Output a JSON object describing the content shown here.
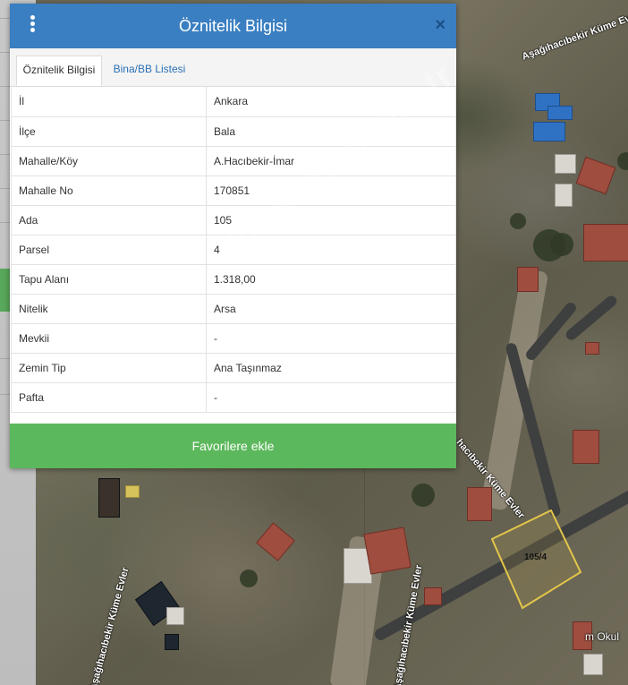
{
  "dialog": {
    "title": "Öznitelik Bilgisi",
    "close_symbol": "×",
    "tabs": [
      {
        "label": "Öznitelik Bilgisi",
        "active": true
      },
      {
        "label": "Bina/BB Listesi",
        "active": false
      }
    ],
    "rows": [
      {
        "key": "İl",
        "value": "Ankara"
      },
      {
        "key": "İlçe",
        "value": "Bala"
      },
      {
        "key": "Mahalle/Köy",
        "value": "A.Hacıbekir-İmar"
      },
      {
        "key": "Mahalle No",
        "value": "170851"
      },
      {
        "key": "Ada",
        "value": "105"
      },
      {
        "key": "Parsel",
        "value": "4"
      },
      {
        "key": "Tapu Alanı",
        "value": "1.318,00"
      },
      {
        "key": "Nitelik",
        "value": "Arsa"
      },
      {
        "key": "Mevkii",
        "value": "-"
      },
      {
        "key": "Zemin Tip",
        "value": "Ana Taşınmaz"
      },
      {
        "key": "Pafta",
        "value": "-"
      }
    ],
    "favorite_button": "Favorilere ekle"
  },
  "map": {
    "road_labels": {
      "top_right": "Aşağıhacıbekir Küme Evler",
      "middle": "hacıbekir Küme Evler",
      "bottom_left": "Aşağıhacıbekir Küme Evler",
      "bottom_center": "Aşağıhacıbekir Küme Evler"
    },
    "poi_label": "m Okul",
    "parcel_label": "105/4"
  },
  "watermark": "www.tapu.com.tr",
  "colors": {
    "header": "#3a7fc1",
    "favorite_button": "#5cb85c",
    "tab_link": "#2a6fb5",
    "parcel_outline": "#e3c64a"
  }
}
